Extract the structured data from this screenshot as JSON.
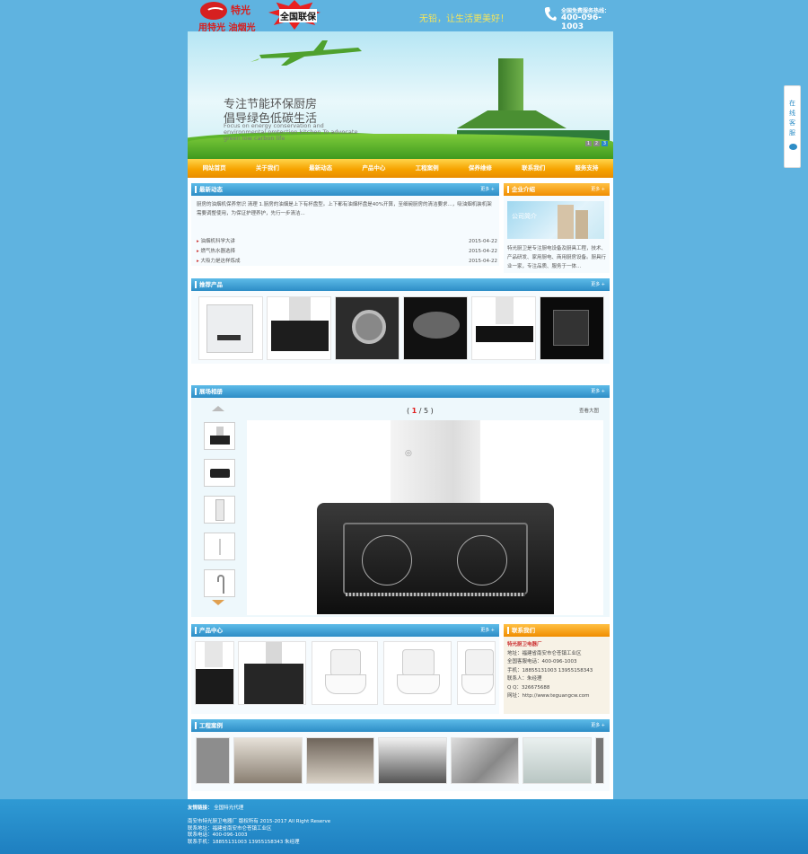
{
  "header": {
    "brand": "特光",
    "slogan": "用特光 油烟光",
    "badge": "全国联保",
    "tagline": "无铅，让生活更美好！",
    "hotline_label": "全国免费服务热线：",
    "hotline_number": "400-096-1003"
  },
  "banner": {
    "heading1": "专注节能环保厨房",
    "heading2": "倡导绿色低碳生活",
    "english": "Focus on energy conservation and environmental protection kitchen To advocate green low carbon life",
    "dots": [
      "1",
      "2",
      "3"
    ]
  },
  "nav": [
    "网站首页",
    "关于我们",
    "最新动态",
    "产品中心",
    "工程案例",
    "保养维修",
    "联系我们",
    "服务支持"
  ],
  "news": {
    "title": "最新动态",
    "more": "更多 +",
    "intro": "厨房的油烟机保养常识     清理    1.厨房的油烟是上下有杯盘型。上下都有油烟杯盘是40%开算，至细碗厨房的清洁要求...，吸油烟机装机架需要调整使用，为保证护理养护，先行一步清洁...",
    "items": [
      {
        "title": "油烟机科学大讲",
        "date": "2015-04-22"
      },
      {
        "title": "燃气热水器选择",
        "date": "2015-04-22"
      },
      {
        "title": "大吸力是这样炼成",
        "date": "2015-04-22"
      }
    ]
  },
  "about": {
    "title": "企业介绍",
    "more": "更多 +",
    "img_caption": "公司简介",
    "text": "特光厨卫是专注厨电设备及厨具工程，技术、产品研发、家用厨电、商用厨房设备。厨具行业一家，专注品质、服务于一体..."
  },
  "recommend": {
    "title": "推荐产品",
    "more": "更多 +"
  },
  "gallery": {
    "title": "展场相册",
    "more": "更多 +",
    "page_current": "1",
    "page_total": "5",
    "view_large": "查看大图"
  },
  "products": {
    "title": "产品中心",
    "more": "更多 +"
  },
  "contact": {
    "title": "联系我们",
    "company": "特光厨卫电器厂",
    "lines": [
      "地址：福建省南安市仑苍镇工业区",
      "全国客服电话：400-096-1003",
      "手机：18855131003 13955158343",
      "联系人：朱经理",
      "Q Q：326675688",
      "网址：http://www.teguangcw.com"
    ]
  },
  "cases": {
    "title": "工程案例",
    "more": "更多 +"
  },
  "footer": {
    "links_label": "友情链接：",
    "links": "全国特光代理",
    "copyright": "南安市特光厨卫电器厂 版权所有 2015-2017 All Right Reserve",
    "address": "联系地址：福建省南安市仑苍镇工业区",
    "hotline": "联系电话：400-096-1003",
    "mobile": "联系手机：18855131003 13955158343 朱经理"
  },
  "side_service": [
    "在",
    "线",
    "客",
    "服"
  ]
}
